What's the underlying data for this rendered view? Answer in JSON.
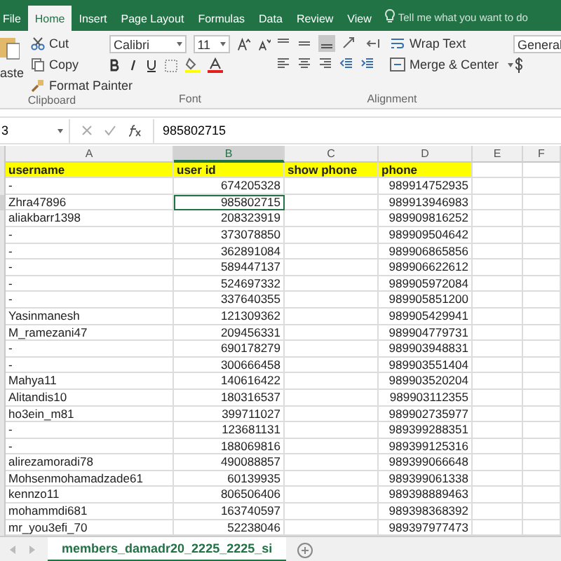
{
  "ribbon_tabs": [
    {
      "label": "File",
      "selected": false
    },
    {
      "label": "Home",
      "selected": true
    },
    {
      "label": "Insert",
      "selected": false
    },
    {
      "label": "Page Layout",
      "selected": false
    },
    {
      "label": "Formulas",
      "selected": false
    },
    {
      "label": "Data",
      "selected": false
    },
    {
      "label": "Review",
      "selected": false
    },
    {
      "label": "View",
      "selected": false
    }
  ],
  "tell_me": "Tell me what you want to do",
  "clipboard": {
    "paste": "aste",
    "cut": "Cut",
    "copy": "Copy",
    "format_painter": "Format Painter",
    "label": "Clipboard"
  },
  "font": {
    "name": "Calibri",
    "size": "11",
    "label": "Font"
  },
  "alignment": {
    "wrap_text": "Wrap Text",
    "merge_center": "Merge & Center",
    "label": "Alignment"
  },
  "number": {
    "format": "General"
  },
  "formula_bar": {
    "name_box": "3",
    "value": "985802715"
  },
  "columns": [
    {
      "label": "A",
      "selected": false
    },
    {
      "label": "B",
      "selected": true
    },
    {
      "label": "C",
      "selected": false
    },
    {
      "label": "D",
      "selected": false
    },
    {
      "label": "E",
      "selected": false
    },
    {
      "label": "F",
      "selected": false
    }
  ],
  "header_row": [
    "username",
    "user id",
    "show phone",
    "phone"
  ],
  "rows": [
    {
      "username": "-",
      "user_id": "674205328",
      "phone": "989914752935",
      "selected": false
    },
    {
      "username": "Zhra47896",
      "user_id": "985802715",
      "phone": "989913946983",
      "selected": true
    },
    {
      "username": "aliakbarr1398",
      "user_id": "208323919",
      "phone": "989909816252",
      "selected": false
    },
    {
      "username": "-",
      "user_id": "373078850",
      "phone": "989909504642",
      "selected": false
    },
    {
      "username": "-",
      "user_id": "362891084",
      "phone": "989906865856",
      "selected": false
    },
    {
      "username": "-",
      "user_id": "589447137",
      "phone": "989906622612",
      "selected": false
    },
    {
      "username": "-",
      "user_id": "524697332",
      "phone": "989905972084",
      "selected": false
    },
    {
      "username": "-",
      "user_id": "337640355",
      "phone": "989905851200",
      "selected": false
    },
    {
      "username": "Yasinmanesh",
      "user_id": "121309362",
      "phone": "989905429941",
      "selected": false
    },
    {
      "username": "M_ramezani47",
      "user_id": "209456331",
      "phone": "989904779731",
      "selected": false
    },
    {
      "username": "-",
      "user_id": "690178279",
      "phone": "989903948831",
      "selected": false
    },
    {
      "username": "-",
      "user_id": "300666458",
      "phone": "989903551404",
      "selected": false
    },
    {
      "username": "Mahya11",
      "user_id": "140616422",
      "phone": "989903520204",
      "selected": false
    },
    {
      "username": "Alitandis10",
      "user_id": "180316537",
      "phone": "989903112355",
      "selected": false
    },
    {
      "username": "ho3ein_m81",
      "user_id": "399711027",
      "phone": "989902735977",
      "selected": false
    },
    {
      "username": "-",
      "user_id": "123681131",
      "phone": "989399288351",
      "selected": false
    },
    {
      "username": "-",
      "user_id": "188069816",
      "phone": "989399125316",
      "selected": false
    },
    {
      "username": "alirezamoradi78",
      "user_id": "490088857",
      "phone": "989399066648",
      "selected": false
    },
    {
      "username": "Mohsenmohamadzade61",
      "user_id": "60139935",
      "phone": "989399061338",
      "selected": false
    },
    {
      "username": "kennzo11",
      "user_id": "806506406",
      "phone": "989398889463",
      "selected": false
    },
    {
      "username": "mohammdi681",
      "user_id": "163740597",
      "phone": "989398368392",
      "selected": false
    },
    {
      "username": "mr_you3efi_70",
      "user_id": "52238046",
      "phone": "989397977473",
      "selected": false
    }
  ],
  "sheet_tabs": [
    {
      "label": "members_damadr20_2225_2225_si",
      "selected": true
    }
  ]
}
